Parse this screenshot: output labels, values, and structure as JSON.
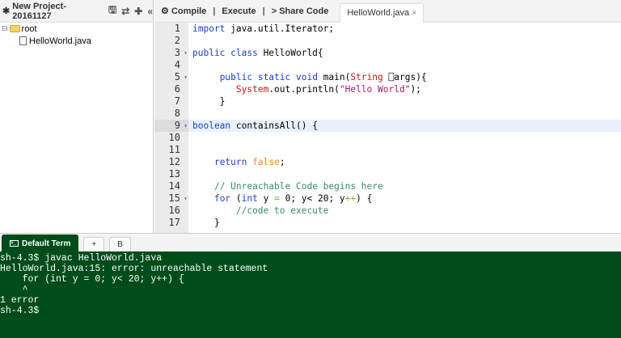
{
  "project": {
    "title": "New Project-20161127",
    "icons": [
      "gear-icon",
      "save-icon",
      "refresh-icon",
      "plus-icon",
      "collapse-icon"
    ],
    "tree": {
      "root": "root",
      "file": "HelloWorld.java"
    }
  },
  "toolbar": {
    "compile": "Compile",
    "execute": "Execute",
    "share": "Share Code",
    "sep": "|",
    "tab": "HelloWorld.java",
    "tab_close": "×"
  },
  "editor": {
    "active_line": 9,
    "fold_lines": [
      3,
      5,
      9,
      15
    ],
    "lines": [
      [
        [
          "import",
          "kw"
        ],
        [
          " java.util.Iterator;",
          ""
        ]
      ],
      [],
      [
        [
          "public class",
          "kw"
        ],
        [
          " HelloWorld{",
          ""
        ]
      ],
      [],
      [
        [
          "     ",
          ""
        ],
        [
          "public static void",
          "kw"
        ],
        [
          " main(",
          ""
        ],
        [
          "String",
          "st"
        ],
        [
          " ⎕args){",
          ""
        ]
      ],
      [
        [
          "        ",
          ""
        ],
        [
          "System",
          "st"
        ],
        [
          ".out.println(",
          ""
        ],
        [
          "\"Hello World\"",
          "str"
        ],
        [
          ");",
          ""
        ]
      ],
      [
        [
          "     }",
          ""
        ]
      ],
      [],
      [
        [
          "boolean",
          "kw"
        ],
        [
          " containsAll() {",
          ""
        ]
      ],
      [],
      [],
      [
        [
          "    ",
          ""
        ],
        [
          "return",
          "kw"
        ],
        [
          " ",
          ""
        ],
        [
          "false",
          "bo"
        ],
        [
          ";",
          ""
        ]
      ],
      [],
      [
        [
          "    ",
          ""
        ],
        [
          "// Unreachable Code begins here",
          "cm"
        ]
      ],
      [
        [
          "    ",
          ""
        ],
        [
          "for",
          "kw"
        ],
        [
          " (",
          ""
        ],
        [
          "int",
          "kw"
        ],
        [
          " y ",
          ""
        ],
        [
          "=",
          "op"
        ],
        [
          " 0; y< 20; y",
          ""
        ],
        [
          "++",
          "op"
        ],
        [
          ") {",
          ""
        ]
      ],
      [
        [
          "        ",
          ""
        ],
        [
          "//code to execute",
          "cm"
        ]
      ],
      [
        [
          "    }",
          ""
        ]
      ]
    ]
  },
  "terminal": {
    "tabs": [
      "Default Term",
      "+",
      "B"
    ],
    "lines": [
      "sh-4.3$ javac HelloWorld.java",
      "HelloWorld.java:15: error: unreachable statement",
      "    for (int y = 0; y< 20; y++) {",
      "    ^",
      "1 error",
      "sh-4.3$"
    ]
  },
  "colors": {
    "terminal_bg": "#004d1a",
    "keyword": "#1a3fc1",
    "comment": "#3a8a6a"
  }
}
